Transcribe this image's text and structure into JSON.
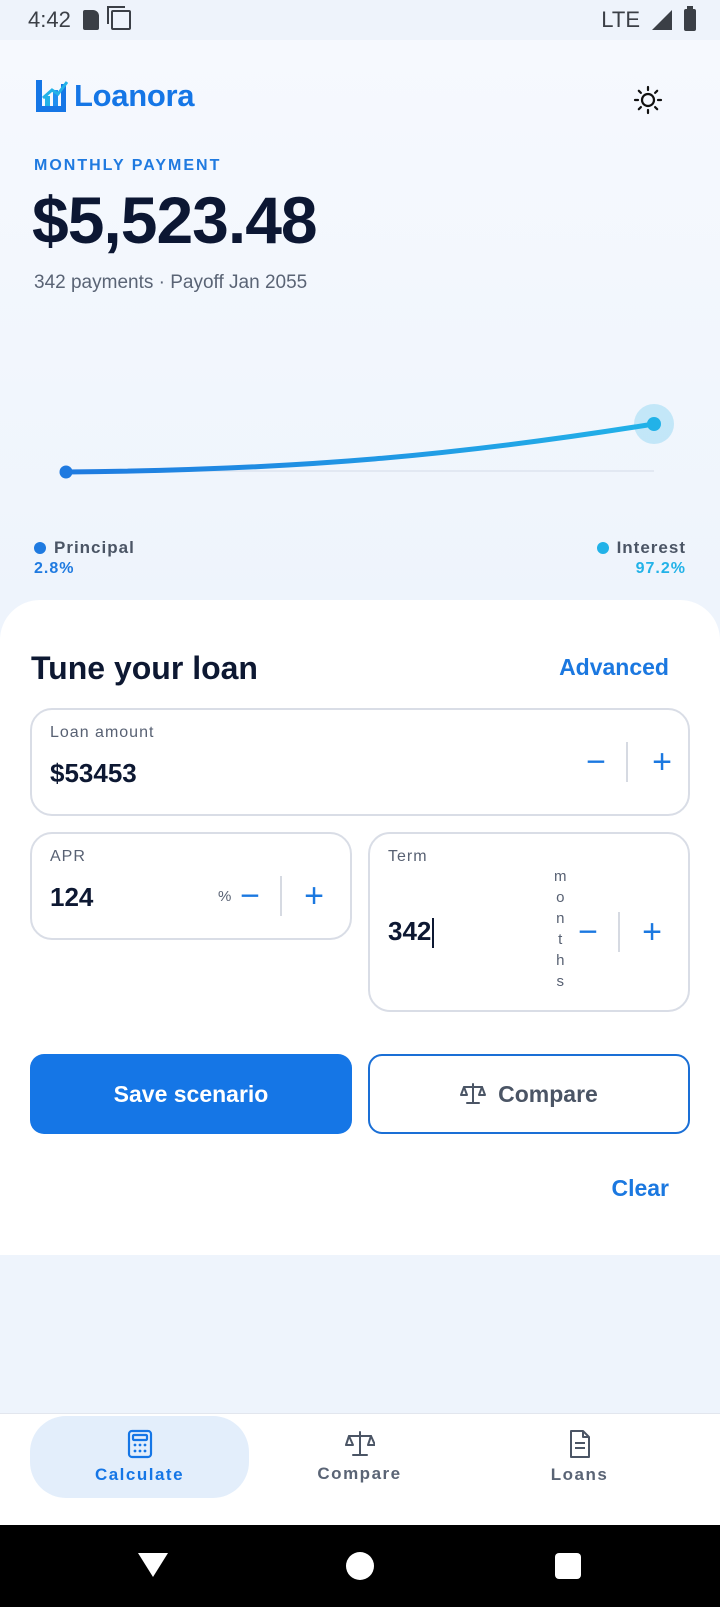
{
  "status_bar": {
    "time": "4:42",
    "network": "LTE"
  },
  "app": {
    "name": "Loanora"
  },
  "summary": {
    "eyebrow": "MONTHLY PAYMENT",
    "amount": "$5,523.48",
    "subline": "342 payments · Payoff Jan 2055"
  },
  "legend": {
    "principal_label": "Principal",
    "principal_value": "2.8%",
    "interest_label": "Interest",
    "interest_value": "97.2%"
  },
  "colors": {
    "primary": "#1576e6",
    "accent": "#22b2e8",
    "principal": "#1f7ae0",
    "interest": "#22b2e8"
  },
  "tune": {
    "title": "Tune your loan",
    "advanced_label": "Advanced",
    "loan_amount": {
      "label": "Loan amount",
      "prefix": "$",
      "value": "53453"
    },
    "apr": {
      "label": "APR",
      "value": "124",
      "unit": "%"
    },
    "term": {
      "label": "Term",
      "value": "342",
      "unit_letters": [
        "m",
        "o",
        "n",
        "t",
        "h",
        "s"
      ]
    },
    "stepper": {
      "minus": "−",
      "plus": "+"
    },
    "save_label": "Save scenario",
    "compare_label": "Compare",
    "clear_label": "Clear"
  },
  "nav": {
    "calculate": "Calculate",
    "compare": "Compare",
    "loans": "Loans"
  }
}
